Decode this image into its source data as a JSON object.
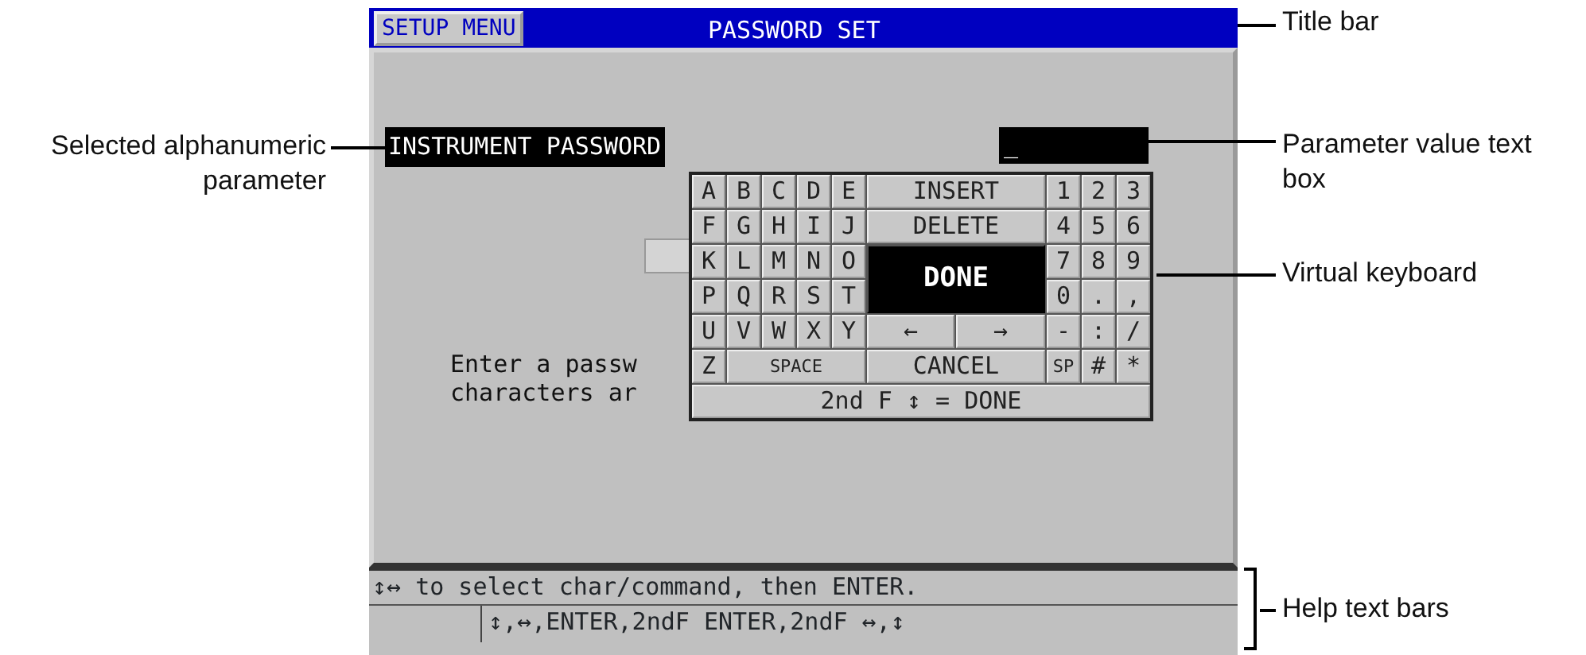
{
  "screen": {
    "title_bar": {
      "menu_tab": "SETUP MENU",
      "title": "PASSWORD SET"
    },
    "parameter": {
      "name": "INSTRUMENT PASSWORD",
      "selected": true,
      "value": "_"
    },
    "message_lines": [
      "Enter a passw",
      "characters ar"
    ],
    "keyboard": {
      "letter_keys": [
        {
          "label": "A",
          "kind": "key",
          "selected": false
        },
        {
          "label": "B",
          "kind": "key",
          "selected": false
        },
        {
          "label": "C",
          "kind": "key",
          "selected": false
        },
        {
          "label": "D",
          "kind": "key",
          "selected": false
        },
        {
          "label": "E",
          "kind": "key",
          "selected": false
        },
        {
          "label": "F",
          "kind": "key",
          "selected": false
        },
        {
          "label": "G",
          "kind": "key",
          "selected": false
        },
        {
          "label": "H",
          "kind": "key",
          "selected": false
        },
        {
          "label": "I",
          "kind": "key",
          "selected": false
        },
        {
          "label": "J",
          "kind": "key",
          "selected": false
        },
        {
          "label": "K",
          "kind": "key",
          "selected": false
        },
        {
          "label": "L",
          "kind": "key",
          "selected": false
        },
        {
          "label": "M",
          "kind": "key",
          "selected": false
        },
        {
          "label": "N",
          "kind": "key",
          "selected": false
        },
        {
          "label": "O",
          "kind": "key",
          "selected": false
        },
        {
          "label": "P",
          "kind": "key",
          "selected": false
        },
        {
          "label": "Q",
          "kind": "key",
          "selected": false
        },
        {
          "label": "R",
          "kind": "key",
          "selected": false
        },
        {
          "label": "S",
          "kind": "key",
          "selected": false
        },
        {
          "label": "T",
          "kind": "key",
          "selected": false
        },
        {
          "label": "U",
          "kind": "key",
          "selected": false
        },
        {
          "label": "V",
          "kind": "key",
          "selected": false
        },
        {
          "label": "W",
          "kind": "key",
          "selected": false
        },
        {
          "label": "X",
          "kind": "key",
          "selected": false
        },
        {
          "label": "Y",
          "kind": "key",
          "selected": false
        },
        {
          "label": "Z",
          "kind": "key",
          "selected": false
        },
        {
          "label": "SPACE",
          "kind": "space",
          "selected": false
        }
      ],
      "command_keys": [
        {
          "label": "INSERT",
          "kind": "wide",
          "selected": false
        },
        {
          "label": "DELETE",
          "kind": "wide",
          "selected": false
        },
        {
          "label": "DONE",
          "kind": "tall",
          "selected": true
        },
        {
          "label": "←",
          "kind": "key",
          "selected": false
        },
        {
          "label": "→",
          "kind": "key",
          "selected": false
        },
        {
          "label": "CANCEL",
          "kind": "wide",
          "selected": false
        }
      ],
      "number_keys": [
        {
          "label": "1",
          "selected": false
        },
        {
          "label": "2",
          "selected": false
        },
        {
          "label": "3",
          "selected": false
        },
        {
          "label": "4",
          "selected": false
        },
        {
          "label": "5",
          "selected": false
        },
        {
          "label": "6",
          "selected": false
        },
        {
          "label": "7",
          "selected": false
        },
        {
          "label": "8",
          "selected": false
        },
        {
          "label": "9",
          "selected": false
        },
        {
          "label": "0",
          "selected": false
        },
        {
          "label": ".",
          "selected": false
        },
        {
          "label": ",",
          "selected": false
        },
        {
          "label": "-",
          "selected": false
        },
        {
          "label": ":",
          "selected": false
        },
        {
          "label": "/",
          "selected": false
        },
        {
          "label": "SP",
          "selected": false
        },
        {
          "label": "#",
          "selected": false
        },
        {
          "label": "*",
          "selected": false
        }
      ],
      "shortcut_bar": "2nd F ↕ = DONE"
    },
    "help_bars": [
      "↕↔ to select char/command, then ENTER.",
      "↕,↔,ENTER,2ndF ENTER,2ndF ↔,↕"
    ]
  },
  "callouts": {
    "left": [
      "Selected alphanumeric parameter"
    ],
    "right": [
      "Title bar",
      "Parameter value text box",
      "Virtual keyboard",
      "Help text bars"
    ]
  }
}
